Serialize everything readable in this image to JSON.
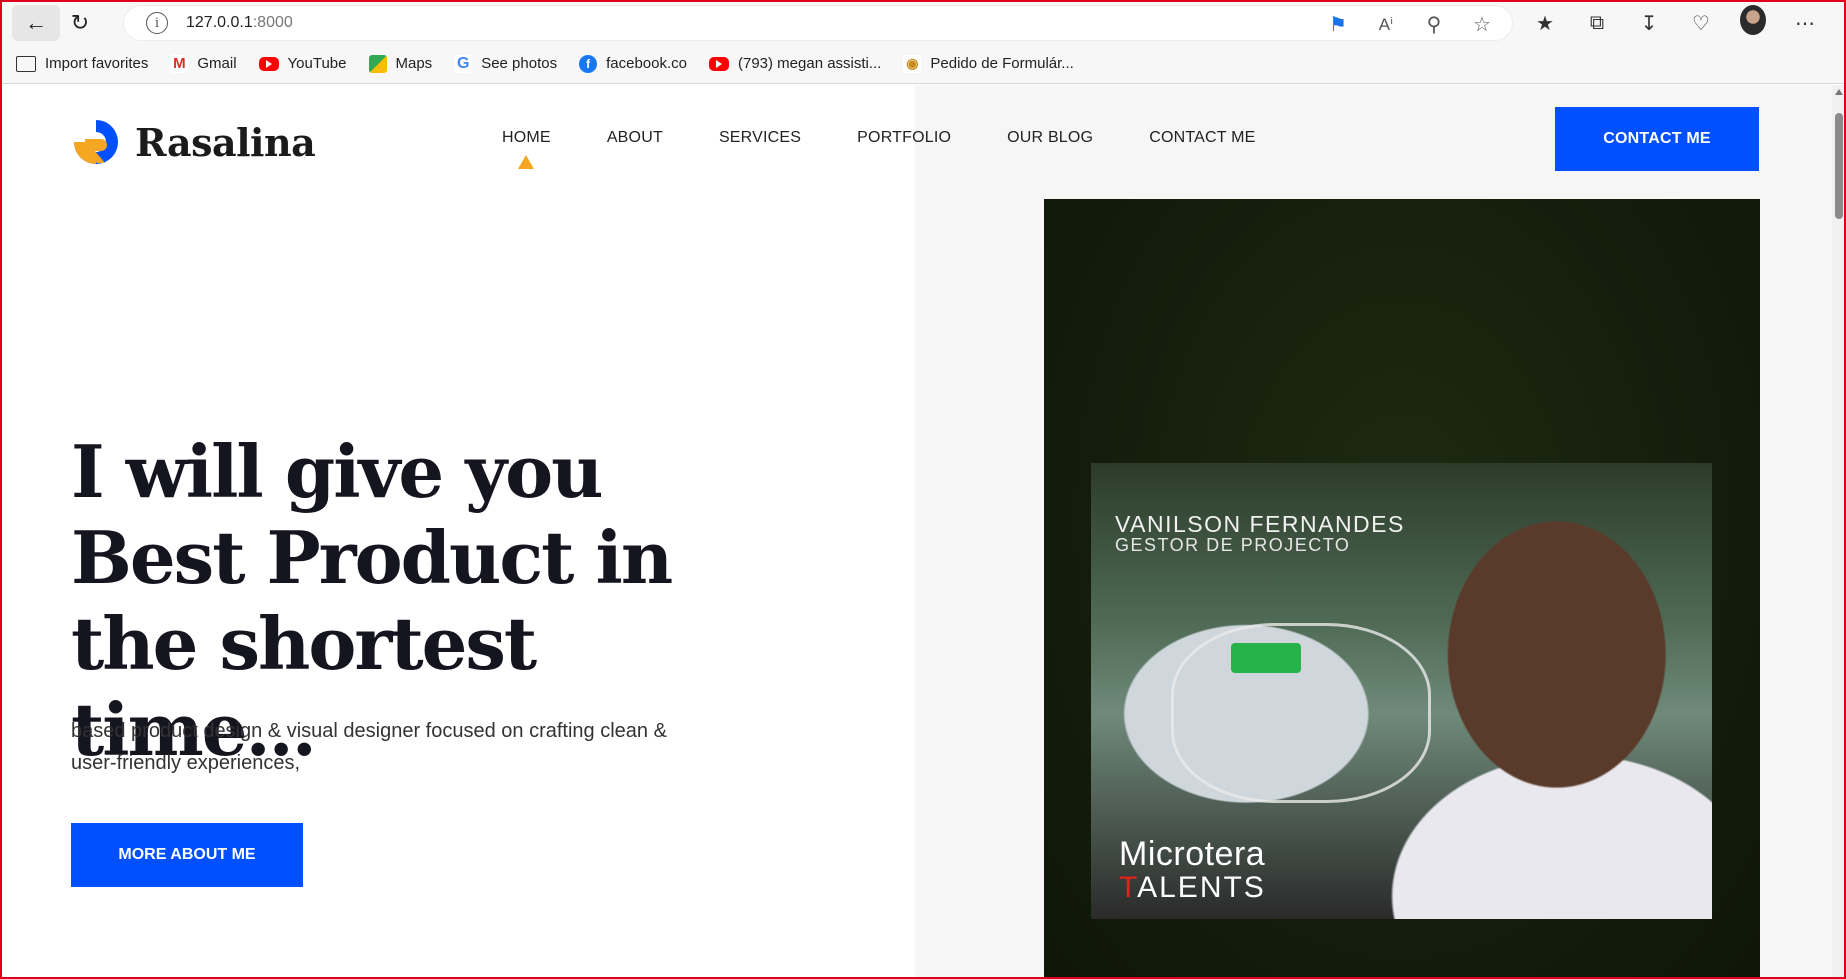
{
  "browser": {
    "url_host": "127.0.0.1",
    "url_port": ":8000",
    "bookmarks": [
      {
        "label": "Import favorites",
        "icon": "folder-icon"
      },
      {
        "label": "Gmail",
        "icon": "gmail-icon"
      },
      {
        "label": "YouTube",
        "icon": "youtube-icon"
      },
      {
        "label": "Maps",
        "icon": "maps-icon"
      },
      {
        "label": "See photos",
        "icon": "google-icon"
      },
      {
        "label": "facebook.co",
        "icon": "facebook-icon"
      },
      {
        "label": "(793) megan assisti...",
        "icon": "youtube-icon"
      },
      {
        "label": "Pedido de Formulár...",
        "icon": "eye-icon"
      }
    ]
  },
  "site": {
    "logo_text": "Rasalina",
    "nav": [
      "HOME",
      "ABOUT",
      "SERVICES",
      "PORTFOLIO",
      "OUR BLOG",
      "CONTACT ME"
    ],
    "active_nav": "HOME",
    "header_cta": "CONTACT ME",
    "hero_title": "I will give you Best Product in the shortest time...",
    "hero_subtitle": "based product design & visual designer focused on crafting clean & user-friendly experiences,",
    "hero_cta": "MORE ABOUT ME",
    "accent_color": "#0050ff",
    "highlight_color": "#f5a623"
  },
  "photo": {
    "name": "VANILSON FERNANDES",
    "role": "GESTOR DE PROJECTO",
    "brand_line1": "Microtera",
    "brand_line2_a": "T",
    "brand_line2_b": "ALENTS"
  }
}
